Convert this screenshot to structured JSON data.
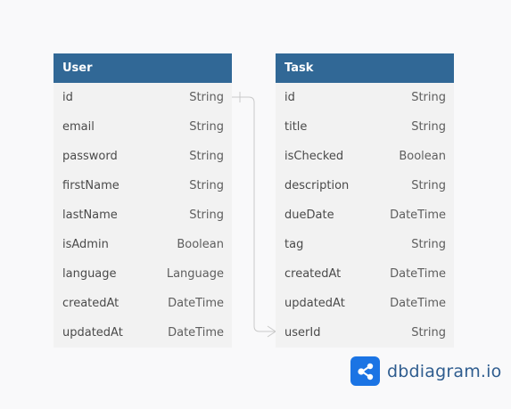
{
  "tables": {
    "user": {
      "title": "User",
      "fields": [
        {
          "name": "id",
          "type": "String"
        },
        {
          "name": "email",
          "type": "String"
        },
        {
          "name": "password",
          "type": "String"
        },
        {
          "name": "firstName",
          "type": "String"
        },
        {
          "name": "lastName",
          "type": "String"
        },
        {
          "name": "isAdmin",
          "type": "Boolean"
        },
        {
          "name": "language",
          "type": "Language"
        },
        {
          "name": "createdAt",
          "type": "DateTime"
        },
        {
          "name": "updatedAt",
          "type": "DateTime"
        }
      ]
    },
    "task": {
      "title": "Task",
      "fields": [
        {
          "name": "id",
          "type": "String"
        },
        {
          "name": "title",
          "type": "String"
        },
        {
          "name": "isChecked",
          "type": "Boolean"
        },
        {
          "name": "description",
          "type": "String"
        },
        {
          "name": "dueDate",
          "type": "DateTime"
        },
        {
          "name": "tag",
          "type": "String"
        },
        {
          "name": "createdAt",
          "type": "DateTime"
        },
        {
          "name": "updatedAt",
          "type": "DateTime"
        },
        {
          "name": "userId",
          "type": "String"
        }
      ]
    }
  },
  "relationship": {
    "from": "User.id",
    "to": "Task.userId",
    "cardinality": "one-to-many"
  },
  "colors": {
    "header": "#316896",
    "row": "#f2f2f2",
    "connector": "#c9c9c9",
    "brand": "#1b74e4"
  },
  "brand": {
    "text": "dbdiagram.io",
    "icon": "share-nodes-icon"
  }
}
